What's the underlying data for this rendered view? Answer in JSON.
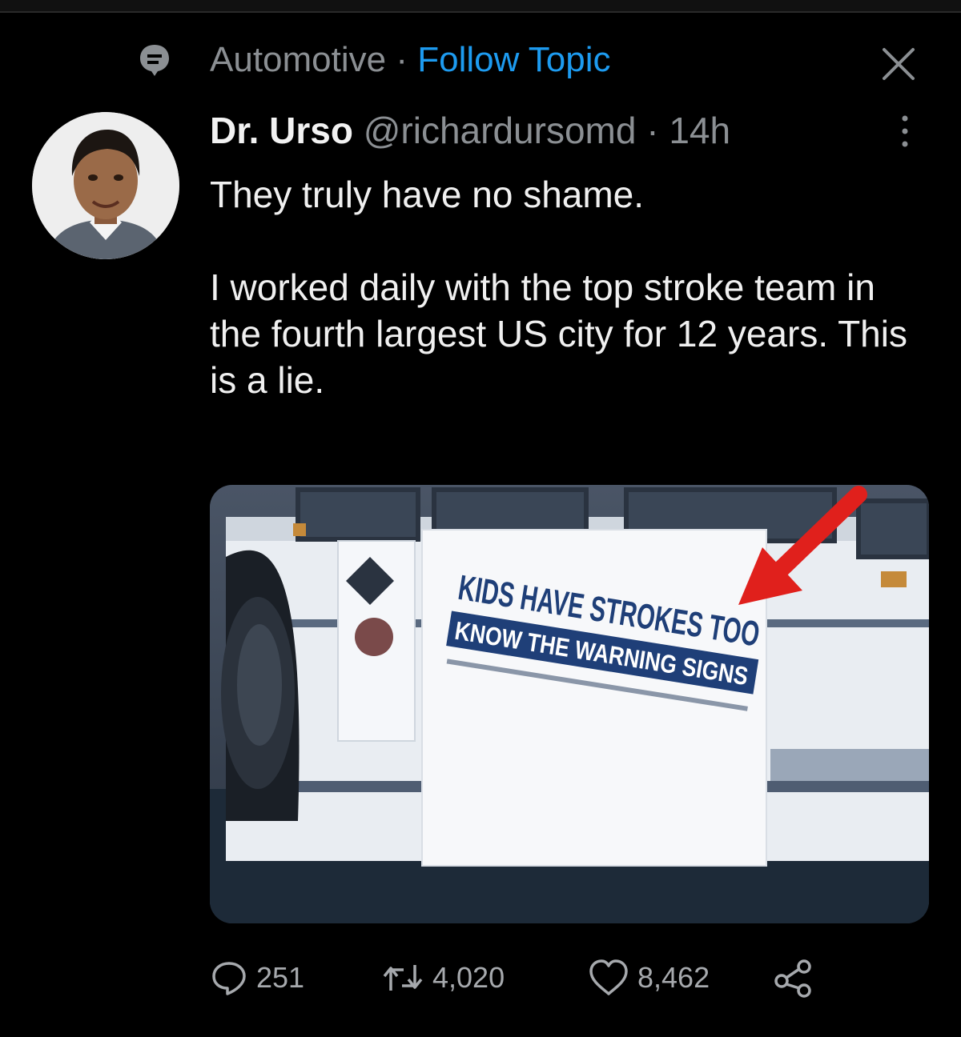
{
  "topic": {
    "name": "Automotive",
    "separator": "·",
    "follow_label": "Follow Topic"
  },
  "tweet": {
    "author_name": "Dr. Urso",
    "author_handle": "@richardursomd",
    "separator": "·",
    "time": "14h",
    "text_line_1": "They truly have no shame.",
    "text_line_2": "I worked daily with the top stroke team in the fourth largest US city for 12 years. This is a lie."
  },
  "media": {
    "sign_line_1": "KIDS HAVE STROKES TOO",
    "sign_line_2": "KNOW THE WARNING SIGNS"
  },
  "actions": {
    "replies": "251",
    "retweets": "4,020",
    "likes": "8,462"
  },
  "icons": {
    "topic": "topic-icon",
    "close": "close-icon",
    "more": "more-icon",
    "reply": "reply-icon",
    "retweet": "retweet-icon",
    "like": "heart-icon",
    "share": "share-icon"
  },
  "colors": {
    "background": "#000000",
    "accent": "#1d9bf0",
    "secondary_text": "#8b8f93",
    "arrow": "#e0201c"
  }
}
